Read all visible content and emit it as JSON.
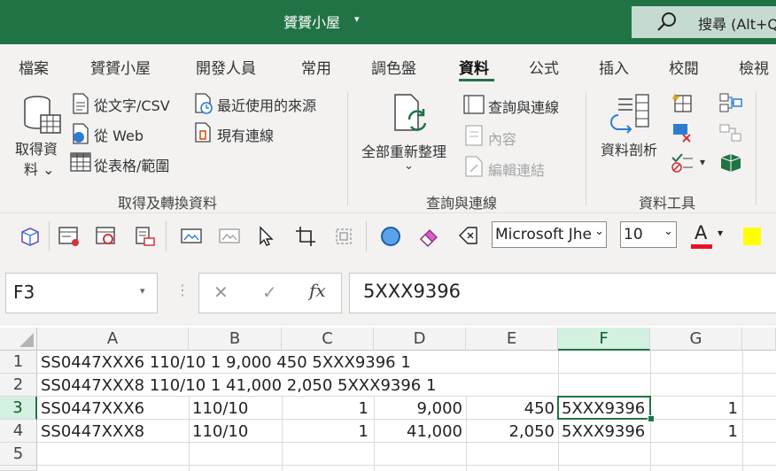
{
  "app": {
    "title": "贇贇小屋",
    "title_caret": "▾"
  },
  "search": {
    "label": "搜尋 (Alt+Q)"
  },
  "tabs": [
    "檔案",
    "贇贇小屋",
    "開發人員",
    "常用",
    "調色盤",
    "資料",
    "公式",
    "插入",
    "校閱",
    "檢視"
  ],
  "active_tab": "資料",
  "ribbon": {
    "get_data": {
      "label_line1": "取得資",
      "label_line2": "料 ⌄"
    },
    "from_text_csv": "從文字/CSV",
    "from_web": "從 Web",
    "from_table_range": "從表格/範圍",
    "recent_sources": "最近使用的來源",
    "existing_connections": "現有連線",
    "refresh_all": {
      "line1": "全部重新整理",
      "line2": "⌄"
    },
    "queries_connections": "查詢與連線",
    "properties": "內容",
    "edit_links": "編輯連結",
    "text_to_columns": "資料剖析",
    "groups": {
      "get_transform": "取得及轉換資料",
      "queries": "查詢與連線",
      "tools": "資料工具"
    }
  },
  "toolbar": {
    "font_name": "Microsoft Jhe",
    "font_size": "10",
    "font_color": "#e81123",
    "fill_color": "#ffff00"
  },
  "formula_bar": {
    "name_box": "F3",
    "formula": "5XXX9396",
    "cancel": "✕",
    "enter": "✓",
    "fx": "fx"
  },
  "grid": {
    "columns": [
      "A",
      "B",
      "C",
      "D",
      "E",
      "F",
      "G"
    ],
    "selected_column": "F",
    "rows": [
      "1",
      "2",
      "3",
      "4",
      "5"
    ],
    "selected_row": "3",
    "row1": {
      "A": "SS0447XXX6 110/10 1 9,000 450 5XXX9396 1"
    },
    "row2": {
      "A": "SS0447XXX8 110/10 1 41,000 2,050 5XXX9396 1"
    },
    "row3": {
      "A": "SS0447XXX6",
      "B": "110/10",
      "C": "1",
      "D": "9,000",
      "E": "450",
      "F": "5XXX9396",
      "G": "1"
    },
    "row4": {
      "A": "SS0447XXX8",
      "B": "110/10",
      "C": "1",
      "D": "41,000",
      "E": "2,050",
      "F": "5XXX9396",
      "G": "1"
    }
  },
  "colors": {
    "accent": "#217346"
  }
}
